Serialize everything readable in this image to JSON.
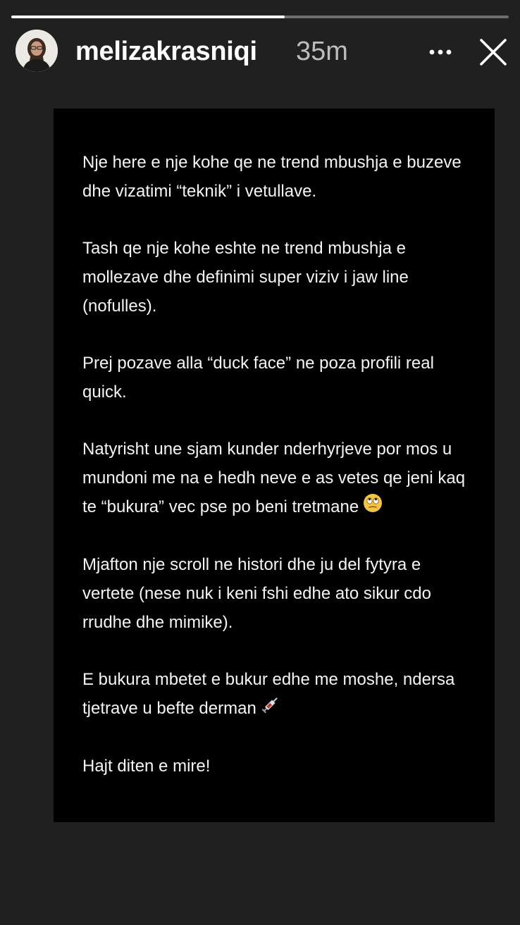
{
  "story": {
    "progress": 0.55
  },
  "header": {
    "username": "melizakrasniqi",
    "timestamp": "35m",
    "avatar_icon": "profile-photo",
    "more_icon": "more-horizontal-icon",
    "close_icon": "close-icon"
  },
  "content": {
    "paragraphs": [
      "Nje here e nje kohe qe ne trend mbushja e buzeve dhe vizatimi “teknik” i vetullave.",
      "Tash qe nje kohe eshte ne trend mbushja e mollezave dhe definimi super viziv i jaw line (nofulles).",
      "Prej pozave alla “duck face” ne poza profili real quick.",
      "Natyrisht une sjam kunder nderhyrjeve por mos u mundoni me na e hedh neve e as vetes qe jeni kaq te “bukura” vec pse po beni tretmane",
      "Mjafton nje scroll ne histori dhe ju del fytyra e vertete (nese nuk i keni fshi edhe ato sikur cdo rrudhe dhe mimike).",
      "E bukura mbetet e bukur edhe me moshe, ndersa tjetrave u befte derman",
      "Hajt diten e mire!"
    ],
    "emoji_eye_roll": "eye-roll-emoji",
    "emoji_syringe": "syringe-emoji"
  },
  "colors": {
    "background": "#202020",
    "card": "#000000",
    "text": "#f4f4f4",
    "timestamp": "#bdbdbd"
  }
}
